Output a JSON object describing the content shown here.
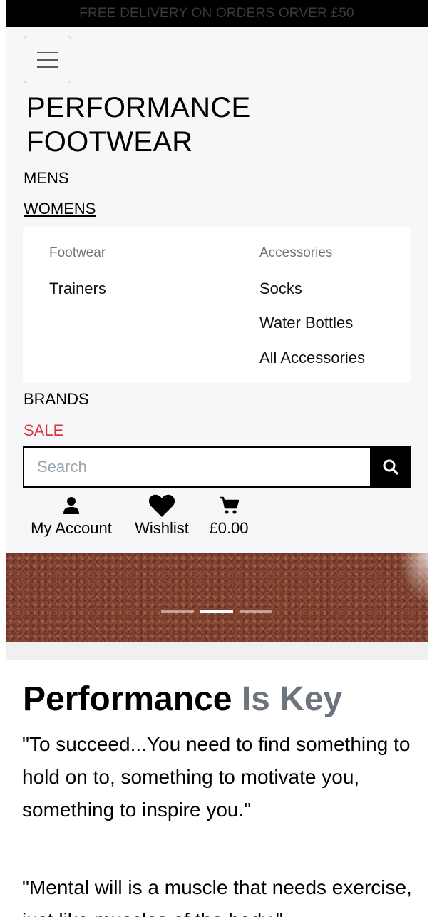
{
  "banner": {
    "text": "FREE DELIVERY ON ORDERS ORVER £50"
  },
  "header": {
    "brand_line1": "PERFORMANCE",
    "brand_line2": "FOOTWEAR"
  },
  "nav": {
    "mens": "MENS",
    "womens": "WOMENS",
    "brands": "BRANDS",
    "sale": "SALE"
  },
  "dropdown": {
    "footwear": {
      "header": "Footwear",
      "items": [
        "Trainers"
      ]
    },
    "accessories": {
      "header": "Accessories",
      "items": [
        "Socks",
        "Water Bottles",
        "All Accessories"
      ]
    }
  },
  "search": {
    "placeholder": "Search"
  },
  "icons": {
    "account": {
      "label": "My Account",
      "icon": "user-icon"
    },
    "wishlist": {
      "label": "Wishlist",
      "icon": "heart-icon"
    },
    "cart": {
      "label": "£0.00",
      "icon": "cart-icon"
    }
  },
  "carousel": {
    "slides": 3,
    "active_slide": 2
  },
  "content": {
    "heading_main": "Performance",
    "heading_muted": "Is Key",
    "quote1": "\"To succeed...You need to find something to hold on to, something to motivate you, something to inspire you.\"",
    "quote2": "\"Mental will is a muscle that needs exercise, just like muscles of the body.\""
  },
  "colors": {
    "sale": "#dc3545",
    "muted": "#6c757d",
    "banner_bg": "#000000"
  }
}
